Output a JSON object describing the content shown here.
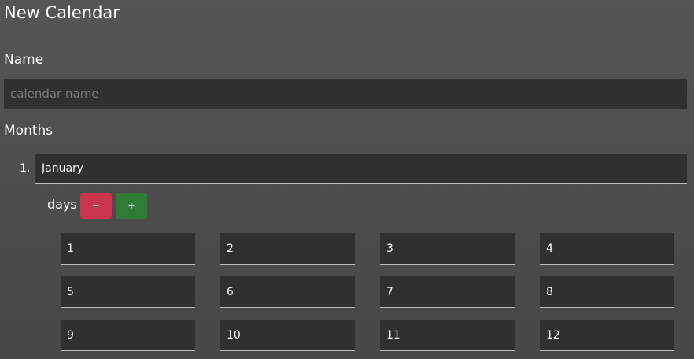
{
  "page": {
    "title": "New Calendar"
  },
  "name_section": {
    "label": "Name",
    "placeholder": "calendar name",
    "value": ""
  },
  "months_section": {
    "label": "Months",
    "months": [
      {
        "number": "1.",
        "name": "January",
        "days_label": "days",
        "remove_day_label": "−",
        "add_day_label": "+",
        "days": [
          "1",
          "2",
          "3",
          "4",
          "5",
          "6",
          "7",
          "8",
          "9",
          "10",
          "11",
          "12"
        ]
      }
    ]
  },
  "colors": {
    "background": "#555555",
    "field_background": "#303030",
    "minus_button": "#c9364c",
    "plus_button": "#2f7d35"
  },
  "icons": {
    "remove_day": "minus-icon",
    "add_day": "plus-icon"
  }
}
